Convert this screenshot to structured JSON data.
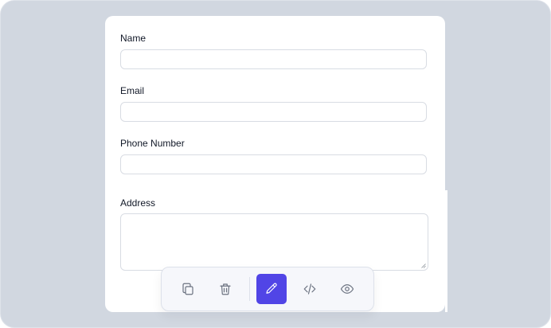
{
  "form": {
    "fields": [
      {
        "label": "Name",
        "value": "",
        "placeholder": ""
      },
      {
        "label": "Email",
        "value": "",
        "placeholder": ""
      },
      {
        "label": "Phone Number",
        "value": "",
        "placeholder": ""
      },
      {
        "label": "Address",
        "value": "",
        "placeholder": ""
      }
    ]
  },
  "toolbar": {
    "buttons": [
      {
        "icon": "copy-icon",
        "active": false
      },
      {
        "icon": "trash-icon",
        "active": false
      },
      {
        "icon": "pencil-icon",
        "active": true
      },
      {
        "icon": "code-icon",
        "active": false
      },
      {
        "icon": "eye-icon",
        "active": false
      }
    ]
  },
  "colors": {
    "background": "#d1d7e0",
    "card": "#ffffff",
    "accent": "#5145e6",
    "input_border": "#d8dce3",
    "icon": "#6b7280"
  }
}
